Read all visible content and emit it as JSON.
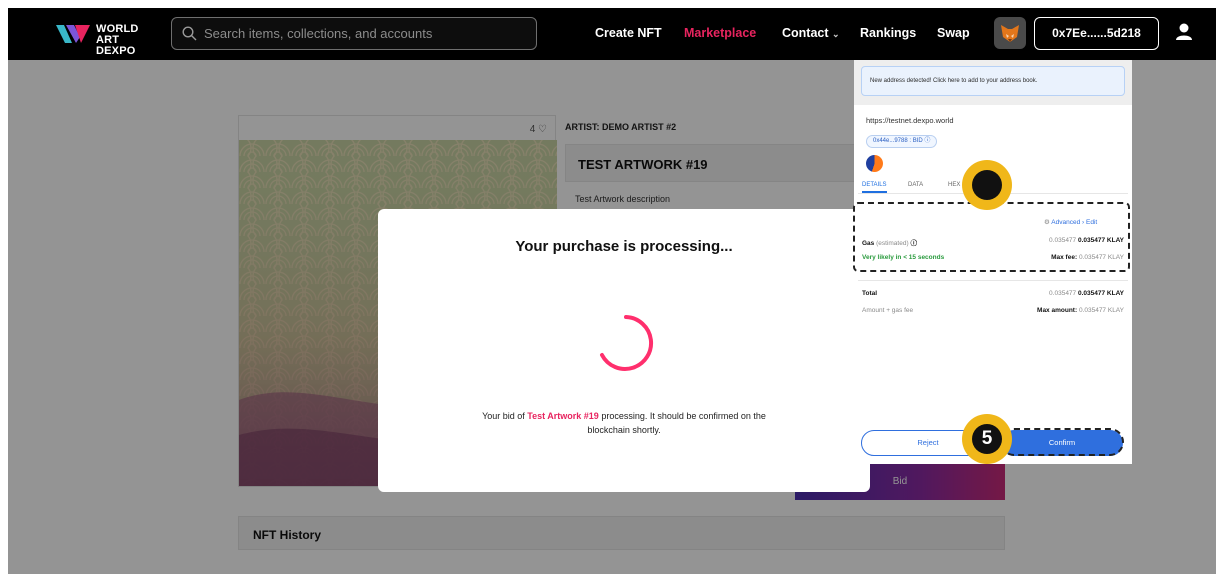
{
  "navbar": {
    "logo_line1": "WORLD",
    "logo_line2": "ART DEXPO",
    "search_placeholder": "Search items, collections, and accounts",
    "links": [
      "Create NFT",
      "Marketplace",
      "Contact",
      "Rankings",
      "Swap"
    ],
    "active_link": "Marketplace",
    "wallet_address": "0x7Ee......5d218",
    "accent_color": "#e8245f"
  },
  "artwork": {
    "likes": "4",
    "artist": "ARTIST: DEMO ARTIST #2",
    "title": "TEST ARTWORK #19",
    "description": "Test Artwork description",
    "bid_label": "Bid",
    "history_title": "NFT History"
  },
  "modal": {
    "title": "Your purchase is processing...",
    "message_prefix": "Your bid of ",
    "message_highlight": "Test Artwork #19",
    "message_suffix": " processing. It should be confirmed on the blockchain shortly."
  },
  "wallet_popup": {
    "notice": "New address detected! Click here to add to your address book.",
    "origin": "https://testnet.dexpo.world",
    "address_pill": "0x44e...9788 : BID",
    "tabs": [
      "DETAILS",
      "DATA",
      "HEX"
    ],
    "active_tab": "DETAILS",
    "advanced": "Advanced",
    "edit": "Edit",
    "gas_label": "Gas",
    "gas_estimated": "(estimated)",
    "gas_value_muted": "0.035477",
    "gas_value": "0.035477 KLAY",
    "likely": "Very likely in < 15 seconds",
    "max_fee_label": "Max fee:",
    "max_fee_value": "0.035477 KLAY",
    "total_label": "Total",
    "total_value_muted": "0.035477",
    "total_value": "0.035477 KLAY",
    "amount_gas": "Amount + gas fee",
    "max_amount_label": "Max amount:",
    "max_amount_value": "0.035477 KLAY",
    "reject": "Reject",
    "confirm": "Confirm"
  },
  "annotations": {
    "badge_confirm": "5",
    "badge_color": "#f0b719"
  }
}
